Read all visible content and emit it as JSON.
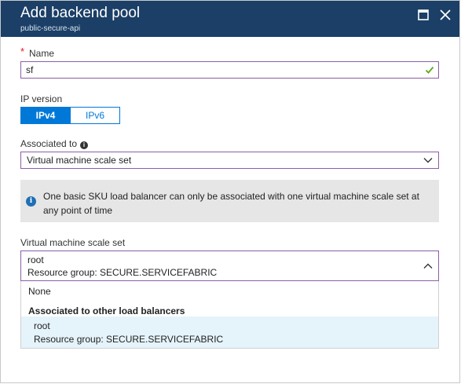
{
  "header": {
    "title": "Add backend pool",
    "subtitle": "public-secure-api",
    "bg_color": "#1b3f66"
  },
  "form": {
    "name": {
      "required_marker": "*",
      "label": "Name",
      "value": "sf",
      "valid_icon": "check-icon"
    },
    "ip_version": {
      "label": "IP version",
      "options": [
        "IPv4",
        "IPv6"
      ],
      "selected": "IPv4",
      "accent": "#0078d7"
    },
    "associated_to": {
      "label": "Associated to",
      "info_icon": "info-icon",
      "value": "Virtual machine scale set"
    },
    "info_message": "One basic SKU load balancer can only be associated with one virtual machine scale set at any point of time",
    "vmss": {
      "label": "Virtual machine scale set",
      "selected_name": "root",
      "selected_rg": "Resource group: SECURE.SERVICEFABRIC",
      "dropdown": {
        "none_option": "None",
        "group_header": "Associated to other load balancers",
        "items": [
          {
            "name": "root",
            "rg": "Resource group: SECURE.SERVICEFABRIC"
          }
        ]
      }
    }
  }
}
